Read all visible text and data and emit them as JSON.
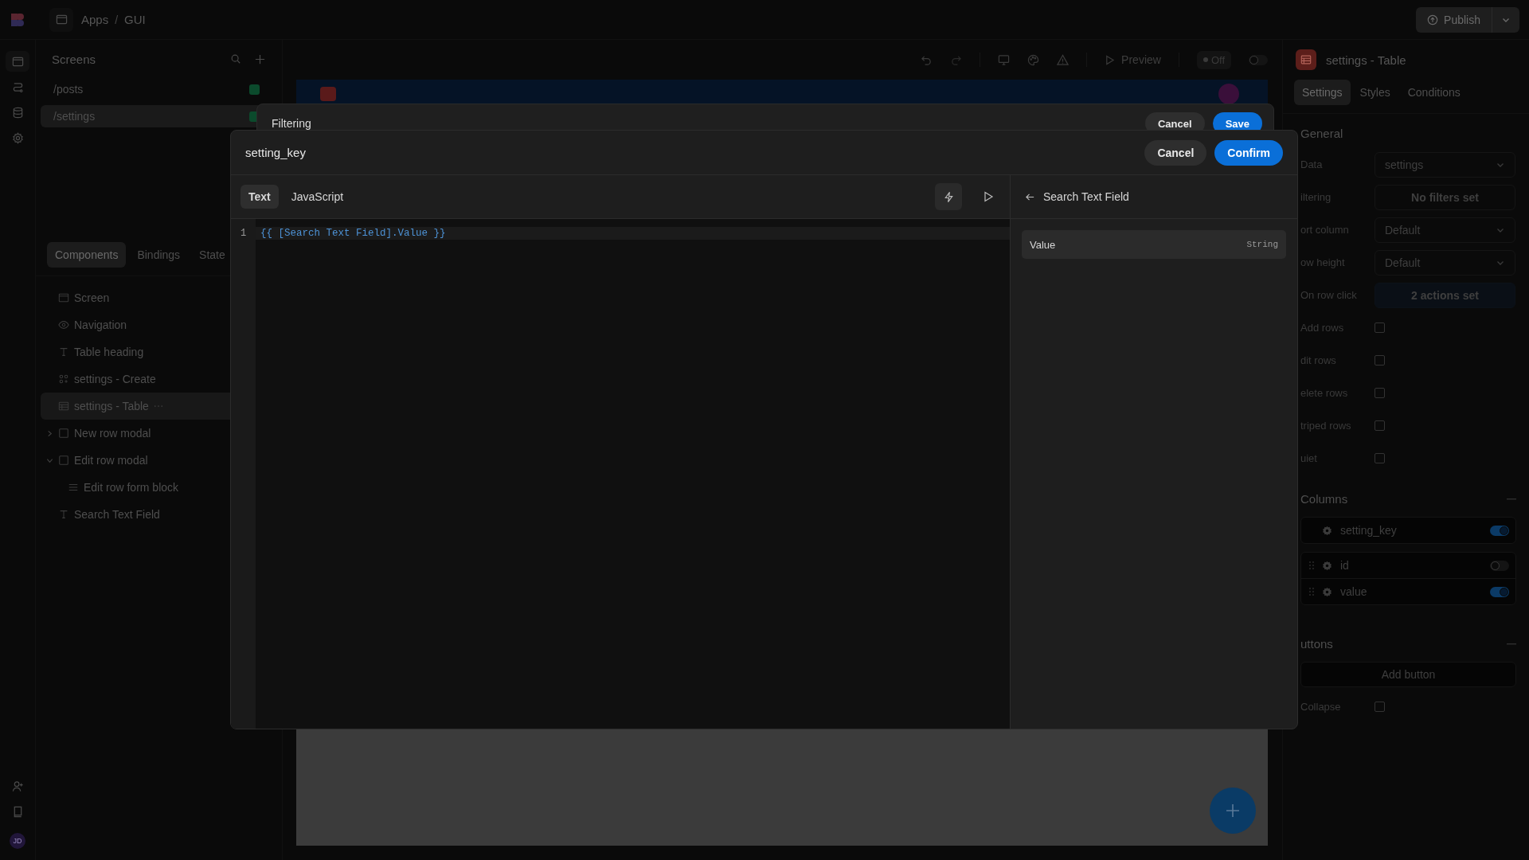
{
  "topbar": {
    "crumbs": [
      "Apps",
      "GUI"
    ],
    "separator": "/",
    "publish": "Publish"
  },
  "avatar": "JD",
  "screens": {
    "title": "Screens",
    "items": [
      {
        "label": "/posts",
        "selected": false
      },
      {
        "label": "/settings",
        "selected": true
      }
    ]
  },
  "panel_tabs": [
    {
      "label": "Components",
      "selected": true
    },
    {
      "label": "Bindings",
      "selected": false
    },
    {
      "label": "State",
      "selected": false
    }
  ],
  "tree": [
    {
      "label": "Screen",
      "kind": "screen",
      "selected": false
    },
    {
      "label": "Navigation",
      "kind": "navigation",
      "selected": false
    },
    {
      "label": "Table heading",
      "kind": "text",
      "selected": false
    },
    {
      "label": "settings - Create",
      "kind": "form",
      "selected": false
    },
    {
      "label": "settings - Table",
      "kind": "table",
      "selected": true
    },
    {
      "label": "New row modal",
      "kind": "modal",
      "selected": false,
      "expanded": false
    },
    {
      "label": "Edit row modal",
      "kind": "modal",
      "selected": false,
      "expanded": true,
      "children": [
        {
          "label": "Edit row form block",
          "kind": "block",
          "selected": false
        }
      ]
    },
    {
      "label": "Search Text Field",
      "kind": "text",
      "selected": false
    }
  ],
  "toolbar": {
    "preview": "Preview",
    "status": "Off",
    "toggle_on": false
  },
  "inspector": {
    "title": "settings - Table",
    "tabs": [
      {
        "label": "Settings",
        "selected": true
      },
      {
        "label": "Styles",
        "selected": false
      },
      {
        "label": "Conditions",
        "selected": false
      }
    ],
    "general_title": "General",
    "properties": [
      {
        "label": "Data",
        "kind": "select",
        "value": "settings"
      },
      {
        "label": "iltering",
        "kind": "action",
        "value": "No filters set",
        "active": false
      },
      {
        "label": "ort column",
        "kind": "select",
        "value": "Default"
      },
      {
        "label": "ow height",
        "kind": "select",
        "value": "Default"
      },
      {
        "label": "On row click",
        "kind": "action",
        "value": "2 actions set",
        "active": true
      },
      {
        "label": "Add rows",
        "kind": "checkbox",
        "checked": false
      },
      {
        "label": "dit rows",
        "kind": "checkbox",
        "checked": false
      },
      {
        "label": "elete rows",
        "kind": "checkbox",
        "checked": false
      },
      {
        "label": "triped rows",
        "kind": "checkbox",
        "checked": false
      },
      {
        "label": "uiet",
        "kind": "checkbox",
        "checked": false
      }
    ],
    "columns_title": "Columns",
    "columns": [
      {
        "name": "setting_key",
        "on": true,
        "handle": false
      },
      {
        "name": "id",
        "on": false,
        "handle": true
      },
      {
        "name": "value",
        "on": true,
        "handle": true
      }
    ],
    "buttons_title": "uttons",
    "add_button": "Add button",
    "collapse": {
      "label": "Collapse",
      "checked": false
    }
  },
  "filter_modal": {
    "title": "Filtering",
    "cancel": "Cancel",
    "save": "Save"
  },
  "binding_modal": {
    "title": "setting_key",
    "cancel": "Cancel",
    "confirm": "Confirm",
    "tabs": [
      {
        "label": "Text",
        "selected": true
      },
      {
        "label": "JavaScript",
        "selected": false
      }
    ],
    "lines": [
      {
        "number": "1",
        "code": "{{ [Search Text Field].Value }}"
      }
    ],
    "side_title": "Search Text Field",
    "fields": [
      {
        "name": "Value",
        "type": "String"
      }
    ]
  }
}
